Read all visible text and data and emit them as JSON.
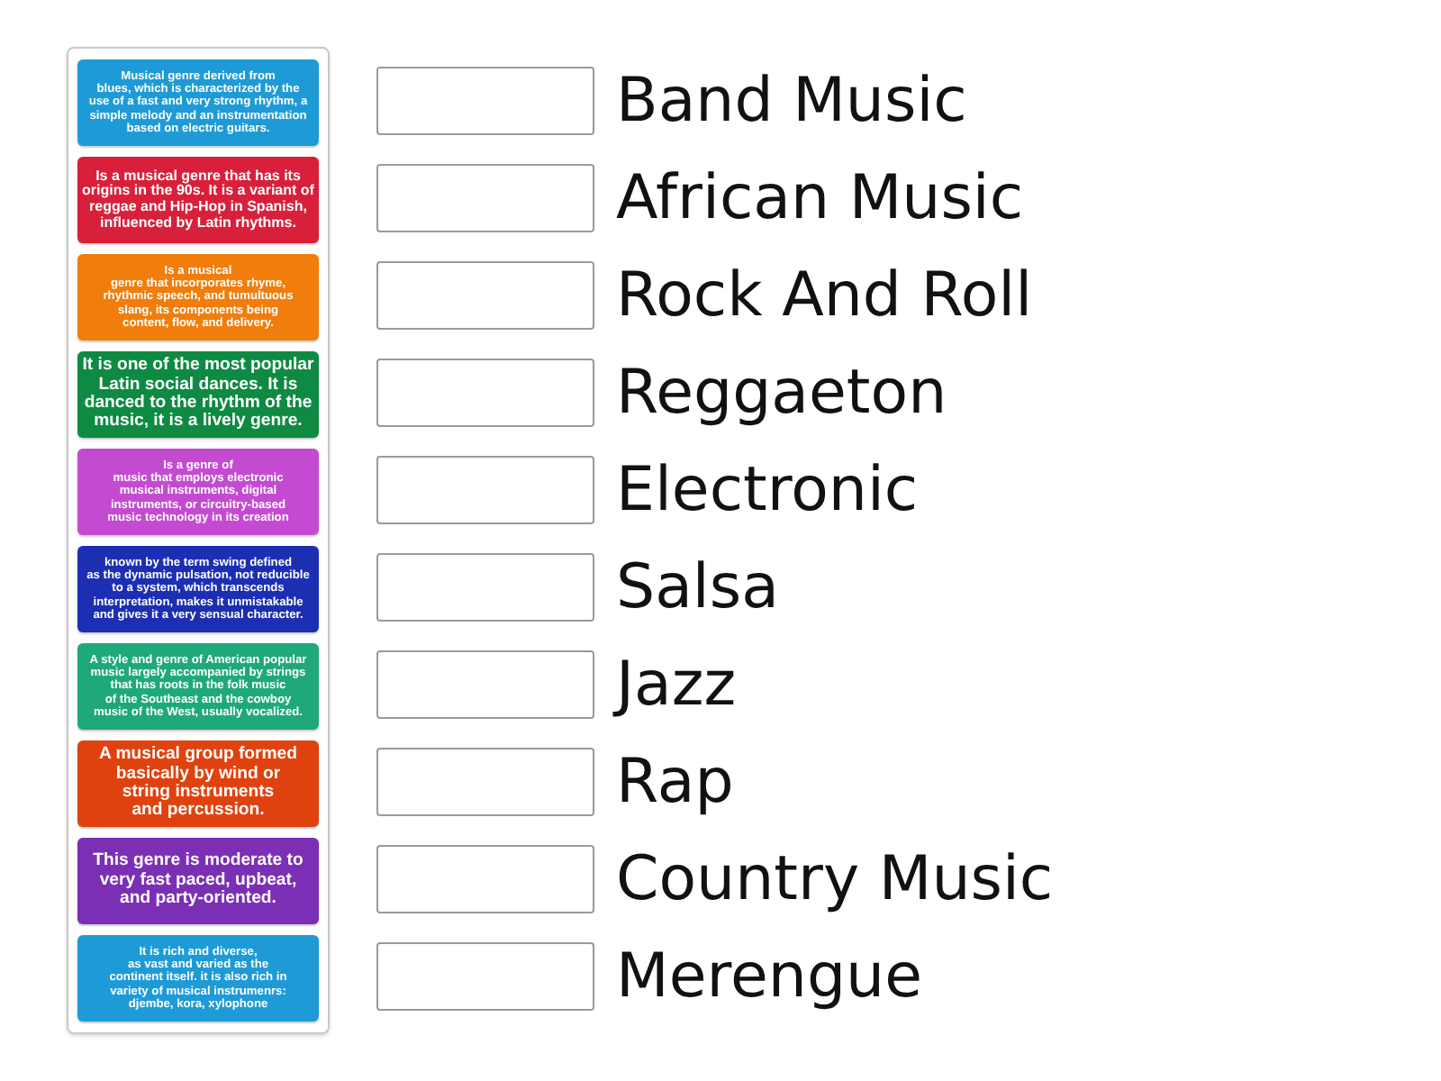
{
  "cards": [
    {
      "text": "Musical genre derived from\nblues, which is characterized by the\nuse of a fast and very strong rhythm, a\nsimple melody and an instrumentation\nbased on electric guitars.",
      "color": "#1e9bd7",
      "kind": "small"
    },
    {
      "text": "Is a musical genre that has its\norigins in the 90s. It is a variant of\nreggae and Hip-Hop in Spanish,\ninfluenced by Latin rhythms.",
      "color": "#d8203a",
      "kind": "medium"
    },
    {
      "text": "Is a musical\ngenre that incorporates rhyme,\nrhythmic speech, and tumultuous\nslang, its components being\ncontent, flow, and delivery.",
      "color": "#f07d0c",
      "kind": "small"
    },
    {
      "text": "It is one of the most popular\nLatin social dances. It is\ndanced to the rhythm of the\nmusic, it is a lively genre.",
      "color": "#0e8a43",
      "kind": "large"
    },
    {
      "text": "Is a genre of\nmusic that employs electronic\nmusical instruments, digital\ninstruments, or circuitry-based\nmusic technology in its creation",
      "color": "#c44bd1",
      "kind": "small"
    },
    {
      "text": "known by the term swing defined\nas the dynamic pulsation, not reducible\nto a system, which transcends\ninterpretation, makes it unmistakable\nand gives it a very sensual character.",
      "color": "#1c2fb3",
      "kind": "small"
    },
    {
      "text": "A style and genre of American popular\nmusic largely accompanied by strings\nthat has roots in the folk music\nof the Southeast and the cowboy\nmusic of the West, usually vocalized.",
      "color": "#1fa97a",
      "kind": "small"
    },
    {
      "text": "A musical group formed\nbasically by wind or\nstring instruments\nand percussion.",
      "color": "#e0420f",
      "kind": "large"
    },
    {
      "text": "This genre is moderate to\nvery fast paced, upbeat,\nand party-oriented.",
      "color": "#7a2fb5",
      "kind": "large"
    },
    {
      "text": "It is rich and diverse,\nas vast and varied as the\ncontinent itself. it is also rich in\nvariety of musical instrumenrs:\ndjembe, kora, xylophone",
      "color": "#1e9bd7",
      "kind": "small"
    }
  ],
  "answers": [
    "Band Music",
    "African Music",
    "Rock And Roll",
    "Reggaeton",
    "Electronic",
    "Salsa",
    "Jazz",
    "Rap",
    "Country Music",
    "Merengue"
  ]
}
